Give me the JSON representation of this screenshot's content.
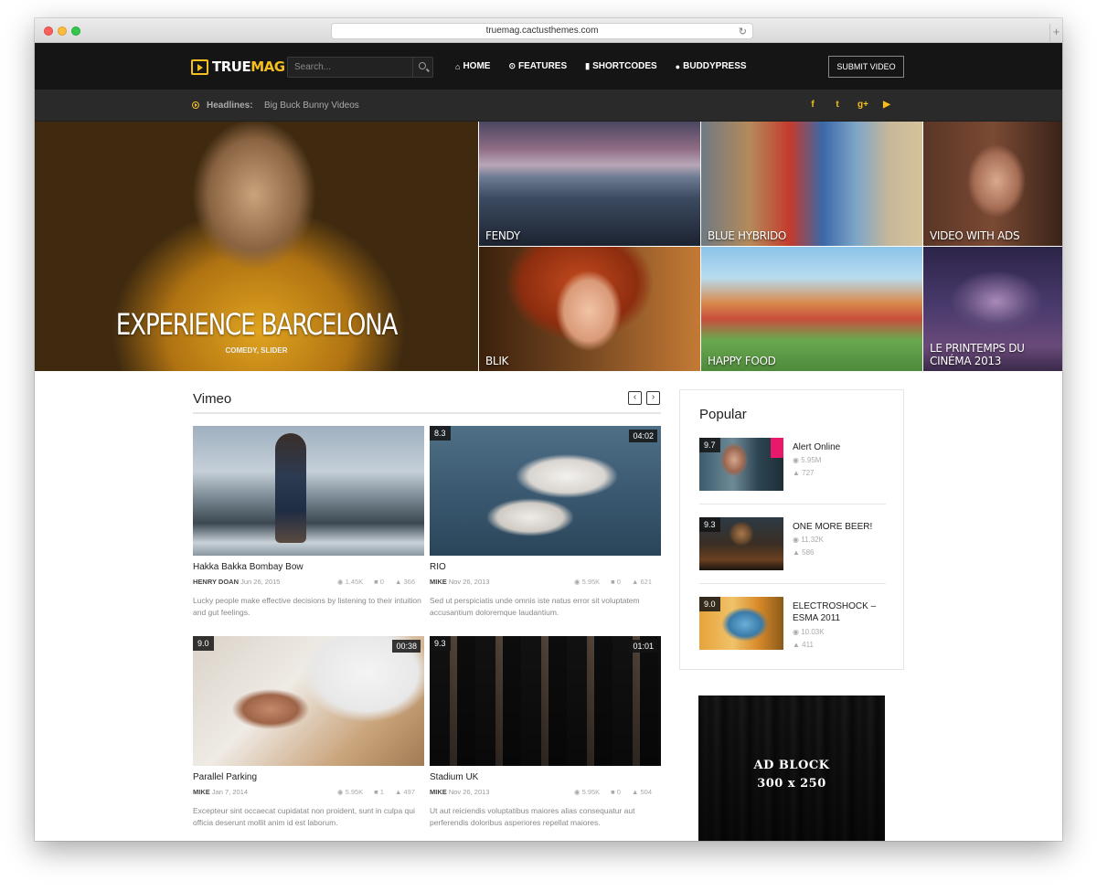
{
  "browser": {
    "url": "truemag.cactusthemes.com",
    "reload_icon": "reload-icon",
    "new_tab_label": "+"
  },
  "header": {
    "logo_true": "TRUE",
    "logo_mag": "MAG",
    "search_placeholder": "Search...",
    "nav": [
      {
        "label": "HOME",
        "icon": "home-icon",
        "glyph": "⌂"
      },
      {
        "label": "FEATURES",
        "icon": "play-circle-icon",
        "glyph": "⊙"
      },
      {
        "label": "SHORTCODES",
        "icon": "bookmark-icon",
        "glyph": "▮"
      },
      {
        "label": "BUDDYPRESS",
        "icon": "user-icon",
        "glyph": "●"
      }
    ],
    "submit_label": "SUBMIT VIDEO"
  },
  "headlines": {
    "label": "Headlines:",
    "text": "Big Buck Bunny Videos",
    "social": [
      "f",
      "t",
      "g+",
      "▶"
    ]
  },
  "hero": {
    "main": {
      "title": "EXPERIENCE BARCELONA",
      "categories": "COMEDY, SLIDER"
    },
    "tiles": [
      "FENDY",
      "BLUE HYBRIDO",
      "VIDEO WITH ADS",
      "BLIK",
      "HAPPY FOOD",
      "LE PRINTEMPS DU CINÉMA 2013"
    ]
  },
  "vimeo": {
    "title": "Vimeo",
    "prev_label": "‹",
    "next_label": "›",
    "cards": [
      {
        "title": "Hakka Bakka Bombay Bow",
        "author": "HENRY DOAN",
        "date": "Jun 26, 2015",
        "views": "1.45K",
        "comments": "0",
        "likes": "366",
        "score": "",
        "duration": "",
        "excerpt": "Lucky people make effective decisions by listening to their intuition and gut feelings."
      },
      {
        "title": "RIO",
        "author": "MIKE",
        "date": "Nov 26, 2013",
        "views": "5.95K",
        "comments": "0",
        "likes": "621",
        "score": "8.3",
        "duration": "04:02",
        "excerpt": "Sed ut perspiciatis unde omnis iste natus error sit voluptatem accusantium doloremque laudantium."
      },
      {
        "title": "Parallel Parking",
        "author": "MIKE",
        "date": "Jan 7, 2014",
        "views": "5.95K",
        "comments": "1",
        "likes": "497",
        "score": "9.0",
        "duration": "00:38",
        "excerpt": "Excepteur sint occaecat cupidatat non proident, sunt in culpa qui officia deserunt mollit anim id est laborum."
      },
      {
        "title": "Stadium UK",
        "author": "MIKE",
        "date": "Nov 26, 2013",
        "views": "5.95K",
        "comments": "0",
        "likes": "504",
        "score": "9.3",
        "duration": "01:01",
        "excerpt": "Ut aut reiciendis voluptatibus maiores alias consequatur aut perferendis doloribus asperiores repellat maiores."
      }
    ]
  },
  "popular": {
    "title": "Popular",
    "items": [
      {
        "name": "Alert Online",
        "score": "9.7",
        "views": "5.95M",
        "likes": "727"
      },
      {
        "name": "ONE MORE BEER!",
        "score": "9.3",
        "views": "11.32K",
        "likes": "586"
      },
      {
        "name": "ELECTROSHOCK – ESMA 2011",
        "score": "9.0",
        "views": "10.03K",
        "likes": "411"
      }
    ]
  },
  "ad": {
    "line1": "AD BLOCK",
    "line2": "300 x 250"
  },
  "colors": {
    "accent": "#f5c01e",
    "topbar": "#151515",
    "headbar": "#2a2a2a"
  }
}
